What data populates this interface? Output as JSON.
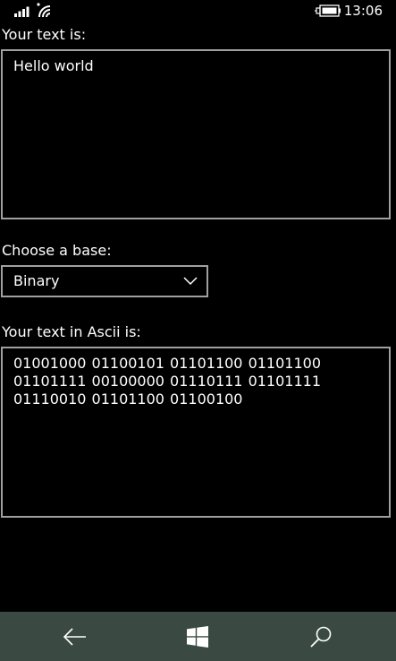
{
  "status_bar": {
    "time": "13:06",
    "icons": [
      "signal-icon",
      "wifi-icon",
      "battery-charging-icon"
    ]
  },
  "input_section": {
    "label": "Your text is:",
    "value": "Hello world"
  },
  "base_section": {
    "label": "Choose a base:",
    "selected": "Binary"
  },
  "output_section": {
    "label": "Your text in Ascii is:",
    "value": "01001000 01100101 01101100 01101100 01101111 00100000 01110111 01101111 01110010 01101100 01100100"
  },
  "nav_bar": {
    "icons": [
      "back-arrow-icon",
      "windows-start-icon",
      "search-icon"
    ]
  },
  "colors": {
    "background": "#000000",
    "text": "#ffffff",
    "border": "#a0a0a0",
    "nav_background": "#3a4a43"
  }
}
